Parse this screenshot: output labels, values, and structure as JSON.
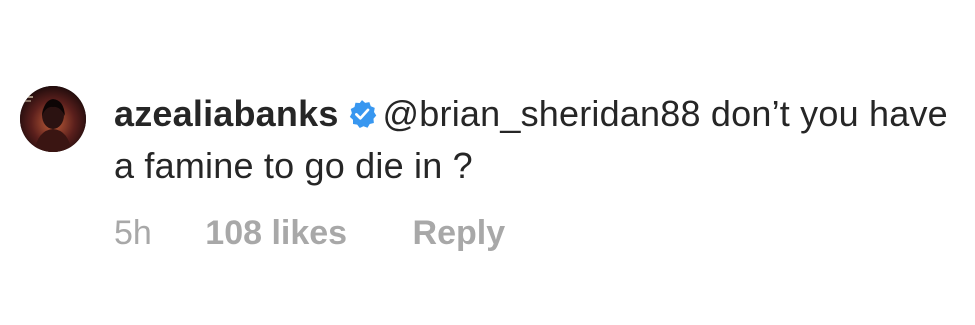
{
  "comment": {
    "username": "azealiabanks",
    "verified_icon": "verified-badge-icon",
    "mention": "@brian_sheridan88",
    "text": " don’t you have a famine to go die in ?",
    "time": "5h",
    "likes": "108 likes",
    "reply_label": "Reply"
  },
  "colors": {
    "text": "#262626",
    "meta": "#a8a8a8",
    "verified_blue": "#3897f0"
  }
}
